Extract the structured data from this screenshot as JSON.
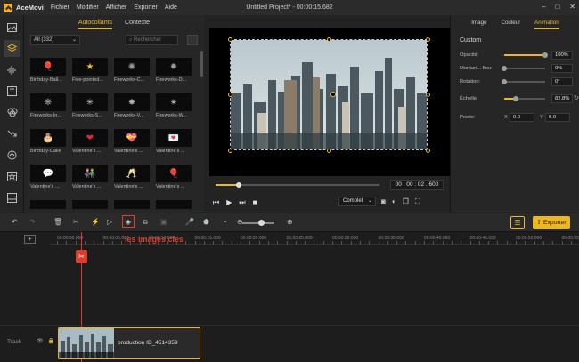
{
  "app": {
    "name": "AceMovi",
    "window_title": "Untitled Project* - 00:00:15.682"
  },
  "menu": [
    "Fichier",
    "Modifier",
    "Afficher",
    "Exporter",
    "Aide"
  ],
  "window_controls": [
    "–",
    "□",
    "✕"
  ],
  "rail_icons": [
    "media-icon",
    "layers-icon",
    "audio-icon",
    "text-icon",
    "filters-icon",
    "transitions-icon",
    "overlays-icon",
    "effects-icon",
    "elements-icon"
  ],
  "media": {
    "tabs": [
      "Autocollants",
      "Contexte"
    ],
    "active_tab": 0,
    "category": "All (332)",
    "search_placeholder": "Rechercher",
    "items": [
      {
        "label": "Birthday-Ball...",
        "glyph": "🎈",
        "color": "#e0434b"
      },
      {
        "label": "Five-pointed...",
        "glyph": "★",
        "color": "#f5c518"
      },
      {
        "label": "Fireworks-C...",
        "glyph": "✺",
        "color": "#9a9a9a"
      },
      {
        "label": "Fireworks-D...",
        "glyph": "✹",
        "color": "#9a9a9a"
      },
      {
        "label": "Fireworks-In...",
        "glyph": "❋",
        "color": "#a0a0a0"
      },
      {
        "label": "Fireworks-S...",
        "glyph": "✳",
        "color": "#c8c8c8"
      },
      {
        "label": "Fireworks-V...",
        "glyph": "✸",
        "color": "#b0b0b0"
      },
      {
        "label": "Fireworks-W...",
        "glyph": "✷",
        "color": "#aaaaaa"
      },
      {
        "label": "Birthday-Cake",
        "glyph": "🎂",
        "color": "#e8a0b8"
      },
      {
        "label": "Valentine's ...",
        "glyph": "❤",
        "color": "#e0243b"
      },
      {
        "label": "Valentine's ...",
        "glyph": "💝",
        "color": "#e04060"
      },
      {
        "label": "Valentine's ...",
        "glyph": "💌",
        "color": "#e8a0b0"
      },
      {
        "label": "Valentine's ...",
        "glyph": "💬",
        "color": "#e05070"
      },
      {
        "label": "Valentine's ...",
        "glyph": "👫",
        "color": "#e06070"
      },
      {
        "label": "Valentine's ...",
        "glyph": "🥂",
        "color": "#e07080"
      },
      {
        "label": "Valentine's ...",
        "glyph": "🎈",
        "color": "#e05040"
      },
      {
        "label": "",
        "glyph": "",
        "color": "#777777"
      },
      {
        "label": "",
        "glyph": "",
        "color": "#777777"
      },
      {
        "label": "",
        "glyph": "",
        "color": "#777777"
      },
      {
        "label": "",
        "glyph": "",
        "color": "#777777"
      }
    ]
  },
  "preview": {
    "timecode": "00 : 00 : 02 . 600",
    "quality": "Complet",
    "progress": 0.14
  },
  "props": {
    "tabs": [
      "Image",
      "Couleur",
      "Animation"
    ],
    "active_tab": 2,
    "section": "Custom",
    "rows": [
      {
        "label": "Opacité:",
        "value": "100%",
        "fill": 1.0
      },
      {
        "label": "Montan... flou:",
        "value": "0%",
        "fill": 0.0
      },
      {
        "label": "Rotation:",
        "value": "0°",
        "fill": 0.0
      },
      {
        "label": "Échelle:",
        "value": "82.8%",
        "fill": 0.28
      }
    ],
    "position_label": "Posite:",
    "pos_x_label": "X",
    "pos_x": "0.0",
    "pos_y_label": "Y",
    "pos_y": "0.0"
  },
  "toolbar": {
    "export_label": "Exporter"
  },
  "timeline": {
    "ticks": [
      "00:00:00.000",
      "00:00:05.000",
      "00:00:10.000",
      "00:00:15.000",
      "00:00:20.000",
      "00:00:25.000",
      "00:00:30.000",
      "00:00:35.000",
      "00:00:40.000",
      "00:00:45.000",
      "00:00:50.000",
      "00:00:55.000"
    ],
    "annotation": "les images clés",
    "track_label": "Track",
    "clip_label": "production ID_4514359"
  },
  "colors": {
    "accent": "#f1b520",
    "highlight": "#e23b2e"
  }
}
